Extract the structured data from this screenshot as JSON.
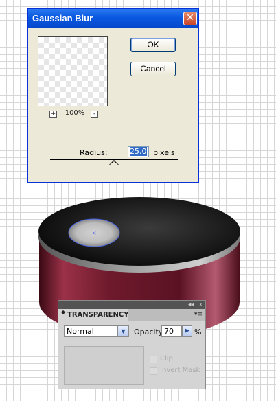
{
  "dialog": {
    "title": "Gaussian Blur",
    "close_glyph": "✕",
    "ok_label": "OK",
    "cancel_label": "Cancel",
    "zoom_in_glyph": "+",
    "zoom_out_glyph": "-",
    "zoom_level": "100%",
    "radius_label": "Radius:",
    "radius_value": "25,0",
    "radius_unit": "pixels"
  },
  "panel": {
    "tab_title": "TRANSPARENCY",
    "tab_arrows": "◆",
    "collapse_glyph": "◂◂",
    "close_glyph": "x",
    "menu_glyph": "▾≡",
    "blend_mode": "Normal",
    "dropdown_glyph": "▼",
    "opacity_label": "Opacity:",
    "opacity_value": "70",
    "opacity_arrow_glyph": "▶",
    "opacity_unit": "%",
    "clip_label": "Clip",
    "invert_mask_label": "Invert Mask"
  },
  "colors": {
    "dialog_bg": "#ece9d8",
    "titlebar_blue": "#0a58e0",
    "cylinder_red": "#7a1f32",
    "disc_black": "#111111",
    "selection_blue": "#4a63e0"
  }
}
